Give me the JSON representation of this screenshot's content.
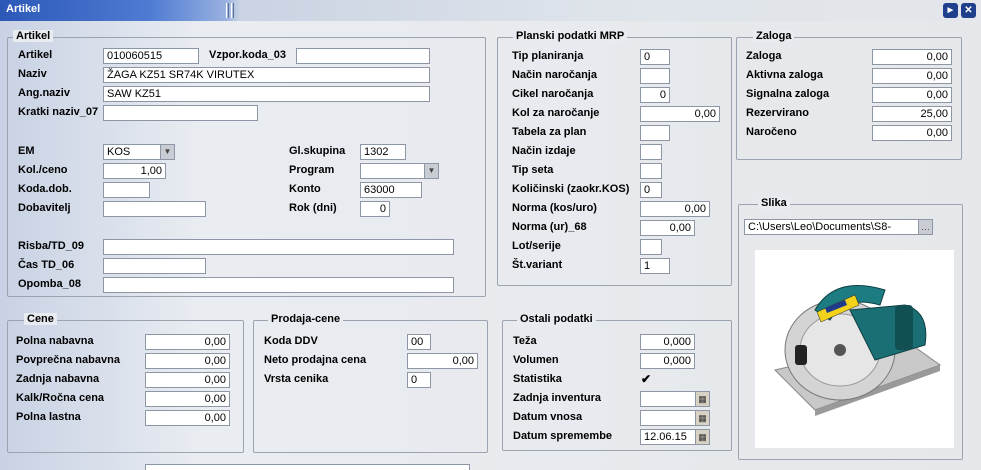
{
  "window": {
    "title": "Artikel",
    "help_icon": "help-icon",
    "close_icon": "close-icon"
  },
  "artikel": {
    "title": "Artikel",
    "artikel_label": "Artikel",
    "artikel_value": "010060515",
    "vzpor_label": "Vzpor.koda_03",
    "vzpor_value": "",
    "naziv_label": "Naziv",
    "naziv_value": "ŽAGA KZ51 SR74K VIRUTEX",
    "angnaziv_label": "Ang.naziv",
    "angnaziv_value": "SAW KZ51",
    "kratki_label": "Kratki naziv_07",
    "kratki_value": "",
    "em_label": "EM",
    "em_value": "KOS",
    "kolceno_label": "Kol./ceno",
    "kolceno_value": "1,00",
    "kodadob_label": "Koda.dob.",
    "kodadob_value": "",
    "dobavitelj_label": "Dobavitelj",
    "dobavitelj_value": "",
    "glskupina_label": "Gl.skupina",
    "glskupina_value": "1302",
    "program_label": "Program",
    "program_value": "",
    "konto_label": "Konto",
    "konto_value": "63000",
    "rok_label": "Rok (dni)",
    "rok_value": "0",
    "risba_label": "Risba/TD_09",
    "risba_value": "",
    "cas_label": "Čas TD_06",
    "cas_value": "",
    "opomba_label": "Opomba_08",
    "opomba_value": ""
  },
  "planski": {
    "title": "Planski podatki MRP",
    "rows": [
      {
        "label": "Tip planiranja",
        "value": "0"
      },
      {
        "label": "Način naročanja",
        "value": ""
      },
      {
        "label": "Cikel naročanja",
        "value": "0"
      },
      {
        "label": "Kol za naročanje",
        "value": "0,00"
      },
      {
        "label": "Tabela za plan",
        "value": ""
      },
      {
        "label": "Način izdaje",
        "value": ""
      },
      {
        "label": "Tip seta",
        "value": ""
      },
      {
        "label": "Količinski (zaokr.KOS)",
        "value": "0"
      },
      {
        "label": "Norma (kos/uro)",
        "value": "0,00"
      },
      {
        "label": "Norma (ur)_68",
        "value": "0,00"
      },
      {
        "label": "Lot/serije",
        "value": ""
      },
      {
        "label": "Št.variant",
        "value": "1"
      }
    ]
  },
  "zaloga": {
    "title": "Zaloga",
    "rows": [
      {
        "label": "Zaloga",
        "value": "0,00"
      },
      {
        "label": "Aktivna zaloga",
        "value": "0,00"
      },
      {
        "label": "Signalna zaloga",
        "value": "0,00"
      },
      {
        "label": "Rezervirano",
        "value": "25,00"
      },
      {
        "label": "Naročeno",
        "value": "0,00"
      }
    ]
  },
  "slika": {
    "title": "Slika",
    "path": "C:\\Users\\Leo\\Documents\\S8-"
  },
  "cene": {
    "title": "Cene",
    "rows": [
      {
        "label": "Polna nabavna",
        "value": "0,00"
      },
      {
        "label": "Povprečna nabavna",
        "value": "0,00"
      },
      {
        "label": "Zadnja nabavna",
        "value": "0,00"
      },
      {
        "label": "Kalk/Ročna cena",
        "value": "0,00"
      },
      {
        "label": "Polna lastna",
        "value": "0,00"
      }
    ]
  },
  "prodaja": {
    "title": "Prodaja-cene",
    "koda_label": "Koda DDV",
    "koda_value": "00",
    "neto_label": "Neto prodajna cena",
    "neto_value": "0,00",
    "vrsta_label": "Vrsta cenika",
    "vrsta_value": "0"
  },
  "ostali": {
    "title": "Ostali podatki",
    "teza_label": "Teža",
    "teza_value": "0,000",
    "volumen_label": "Volumen",
    "volumen_value": "0,000",
    "statistika_label": "Statistika",
    "statistika_checked": "✔",
    "inventura_label": "Zadnja inventura",
    "inventura_value": "",
    "vnos_label": "Datum vnosa",
    "vnos_value": "",
    "sprememba_label": "Datum spremembe",
    "sprememba_value": "12.06.15"
  }
}
